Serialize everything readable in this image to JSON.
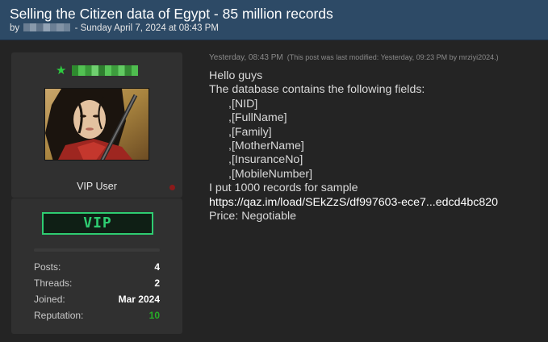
{
  "thread": {
    "title": "Selling the Citizen data of Egypt - 85 million records",
    "by": "by",
    "date": "- Sunday April 7, 2024 at 08:43 PM"
  },
  "user": {
    "role": "VIP User",
    "badge": "VIP",
    "stats": [
      {
        "label": "Posts:",
        "value": "4"
      },
      {
        "label": "Threads:",
        "value": "2"
      },
      {
        "label": "Joined:",
        "value": "Mar 2024"
      },
      {
        "label": "Reputation:",
        "value": "10"
      }
    ],
    "colors": {
      "name": "#2ecc40",
      "badge": "#2ecc71",
      "reputation": "#27ae27",
      "status": "#8b1a1a"
    }
  },
  "post": {
    "timestamp": "Yesterday, 08:43 PM",
    "modified": "(This post was last modified: Yesterday, 09:23 PM by mrziyi2024.)",
    "lines": {
      "greeting": "Hello guys",
      "intro": "The database contains the following fields:",
      "fields": [
        ",[NID]",
        ",[FullName]",
        ",[Family]",
        ",[MotherName]",
        ",[InsuranceNo]",
        ",[MobileNumber]"
      ],
      "sample": "I put 1000 records for sample",
      "link": "https://qaz.im/load/SEkZzS/df997603-ece7...edcd4bc820",
      "price": "Price: Negotiable"
    }
  },
  "icons": {
    "star": "star-icon",
    "online": "status-dot"
  }
}
